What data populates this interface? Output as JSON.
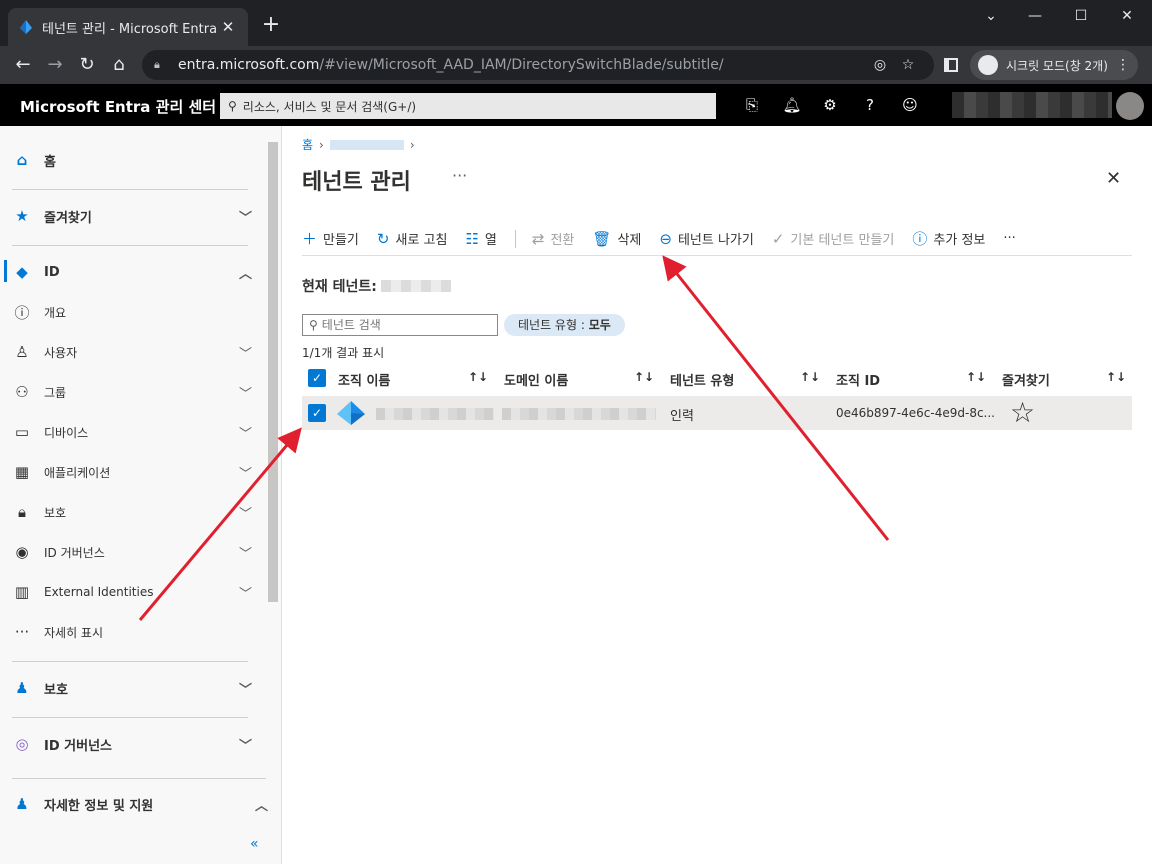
{
  "browser": {
    "tab_title": "테넌트 관리 - Microsoft Entra 관",
    "tab_close": "✕",
    "new_tab": "+",
    "url_main": "entra.microsoft.com",
    "url_rest": "/#view/Microsoft_AAD_IAM/DirectorySwitchBlade/subtitle/",
    "incognito_label": "시크릿 모드(창 2개)"
  },
  "app": {
    "title": "Microsoft Entra 관리 센터",
    "search_placeholder": "리소스, 서비스 및 문서 검색(G+/)"
  },
  "sidebar": {
    "home": "홈",
    "favorites": "즐겨찾기",
    "id": "ID",
    "overview": "개요",
    "users": "사용자",
    "groups": "그룹",
    "devices": "디바이스",
    "applications": "애플리케이션",
    "protection": "보호",
    "id_governance": "ID 거버넌스",
    "external_identities": "External Identities",
    "show_more": "자세히 표시",
    "protection_section": "보호",
    "id_governance_section": "ID 거버넌스",
    "learn_support": "자세한 정보 및 지원",
    "collapse": "«"
  },
  "main": {
    "breadcrumb_home": "홈",
    "title": "테넌트 관리",
    "title_more": "···",
    "close": "✕",
    "commands": {
      "create": "만들기",
      "refresh": "새로 고침",
      "columns": "열",
      "switch": "전환",
      "delete": "삭제",
      "leave": "테넌트 나가기",
      "make_default": "기본 테넌트 만들기",
      "more_info": "추가 정보",
      "overflow": "···"
    },
    "current_tenant_label": "현재 테넌트:",
    "tenant_search_placeholder": "테넌트 검색",
    "filter_label": "테넌트 유형 : ",
    "filter_value": "모두",
    "result_count": "1/1개 결과 표시",
    "columns": {
      "org_name": "조직 이름",
      "domain": "도메인 이름",
      "tenant_type": "테넌트 유형",
      "org_id": "조직 ID",
      "favorites": "즐겨찾기"
    },
    "rows": [
      {
        "tenant_type": "인력",
        "org_id": "0e46b897-4e6c-4e9d-8c...",
        "favorite": "☆",
        "selected": true
      }
    ]
  },
  "colors": {
    "accent": "#0078d4",
    "arrow": "#e0202e",
    "header_bg": "#000000",
    "sidebar_bg": "#f8f8f8"
  }
}
